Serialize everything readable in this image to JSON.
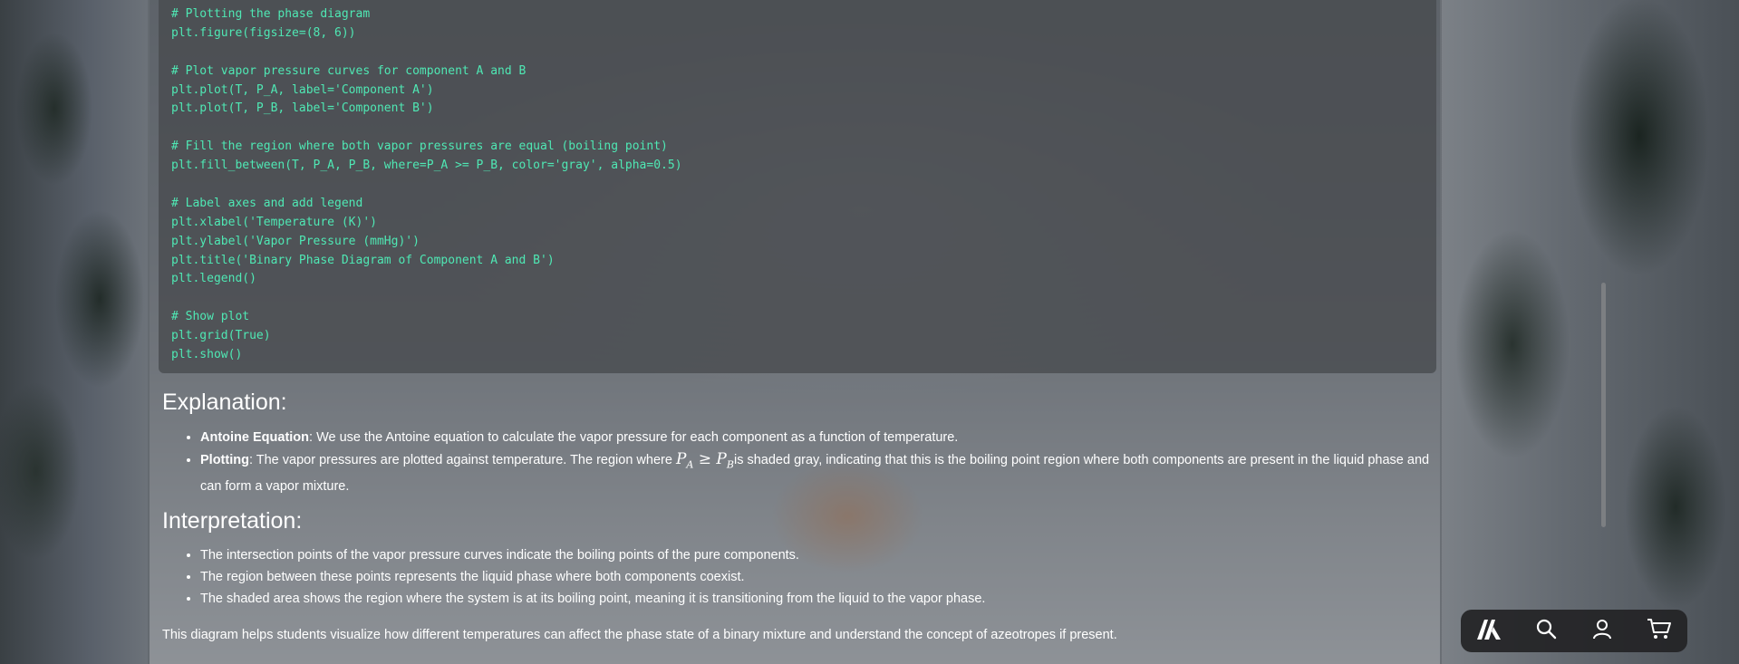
{
  "code": {
    "lines": [
      "# Plotting the phase diagram",
      "plt.figure(figsize=(8, 6))",
      "",
      "# Plot vapor pressure curves for component A and B",
      "plt.plot(T, P_A, label='Component A')",
      "plt.plot(T, P_B, label='Component B')",
      "",
      "# Fill the region where both vapor pressures are equal (boiling point)",
      "plt.fill_between(T, P_A, P_B, where=P_A >= P_B, color='gray', alpha=0.5)",
      "",
      "# Label axes and add legend",
      "plt.xlabel('Temperature (K)')",
      "plt.ylabel('Vapor Pressure (mmHg)')",
      "plt.title('Binary Phase Diagram of Component A and B')",
      "plt.legend()",
      "",
      "# Show plot",
      "plt.grid(True)",
      "plt.show()"
    ],
    "text_color": "#4fe8b4"
  },
  "explanation": {
    "title": "Explanation:",
    "items": [
      {
        "term": "Antoine Equation",
        "text": ": We use the Antoine equation to calculate the vapor pressure for each component as a function of temperature."
      },
      {
        "term": "Plotting",
        "text_before": ": The vapor pressures are plotted against temperature. The region where ",
        "math": {
          "a": "P",
          "a_sub": "A",
          "op": "≥",
          "b": "P",
          "b_sub": "B"
        },
        "text_after": "is shaded gray, indicating that this is the boiling point region where both components are present in the liquid phase and can form a vapor mixture."
      }
    ]
  },
  "interpretation": {
    "title": "Interpretation:",
    "items": [
      "The intersection points of the vapor pressure curves indicate the boiling points of the pure components.",
      "The region between these points represents the liquid phase where both components coexist.",
      "The shaded area shows the region where the system is at its boiling point, meaning it is transitioning from the liquid to the vapor phase."
    ]
  },
  "closing": "This diagram helps students visualize how different temperatures can affect the phase state of a binary mixture and understand the concept of azeotropes if present.",
  "navbar": {
    "items": [
      {
        "icon": "logo-icon"
      },
      {
        "icon": "search-icon"
      },
      {
        "icon": "user-icon"
      },
      {
        "icon": "cart-icon"
      }
    ]
  }
}
